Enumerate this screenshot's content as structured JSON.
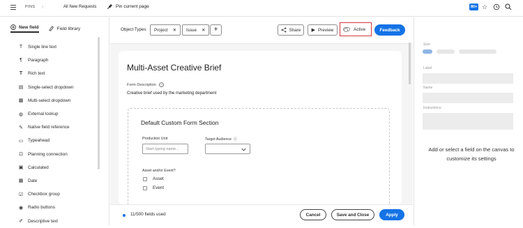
{
  "topbar": {
    "breadcrumb_root": "PINS",
    "breadcrumb_current": "All New Requests",
    "pin_label": "Pin current page",
    "notification_count": "80+"
  },
  "left_panel": {
    "tabs": [
      {
        "label": "New field",
        "active": true
      },
      {
        "label": "Field library",
        "active": false
      }
    ],
    "field_types": [
      {
        "label": "Single line text",
        "icon": "text-icon"
      },
      {
        "label": "Paragraph",
        "icon": "paragraph-icon"
      },
      {
        "label": "Rich text",
        "icon": "rich-text-icon"
      },
      {
        "label": "Single-select dropdown",
        "icon": "dropdown-icon"
      },
      {
        "label": "Multi-select dropdown",
        "icon": "multi-dropdown-icon"
      },
      {
        "label": "External lookup",
        "icon": "globe-icon"
      },
      {
        "label": "Native field reference",
        "icon": "pin-icon"
      },
      {
        "label": "Typeahead",
        "icon": "typeahead-icon"
      },
      {
        "label": "Planning connection",
        "icon": "connection-icon"
      },
      {
        "label": "Calculated",
        "icon": "calculator-icon"
      },
      {
        "label": "Date",
        "icon": "calendar-icon"
      },
      {
        "label": "Checkbox group",
        "icon": "checkbox-icon"
      },
      {
        "label": "Radio buttons",
        "icon": "radio-icon"
      },
      {
        "label": "Descriptive text",
        "icon": "description-icon"
      }
    ]
  },
  "toolbar": {
    "object_types_label": "Object Types",
    "object_types": [
      "Project",
      "Issue"
    ],
    "share_label": "Share",
    "preview_label": "Preview",
    "active_label": "Active",
    "feedback_label": "Feedback"
  },
  "form": {
    "title": "Multi-Asset Creative Brief",
    "description_label": "Form Description",
    "description_value": "Creative brief used by the marketing department",
    "section_title": "Default Custom Form Section",
    "production_unit_label": "Production Unit",
    "production_unit_placeholder": "Start typing name...",
    "target_audience_label": "Target Audience",
    "asset_event_label": "Asset and/or Event?",
    "asset_event_options": [
      "Asset",
      "Event"
    ]
  },
  "footer": {
    "fields_used": "11/500 fields used",
    "cancel_label": "Cancel",
    "save_close_label": "Save and Close",
    "apply_label": "Apply"
  },
  "right_panel": {
    "size_label": "Size",
    "label_label": "Label",
    "name_label": "Name",
    "instructions_label": "Instructions",
    "empty_message": "Add or select a field on the canvas to customize its settings"
  },
  "colors": {
    "accent": "#1473e6",
    "highlight_border": "#d7373f"
  }
}
